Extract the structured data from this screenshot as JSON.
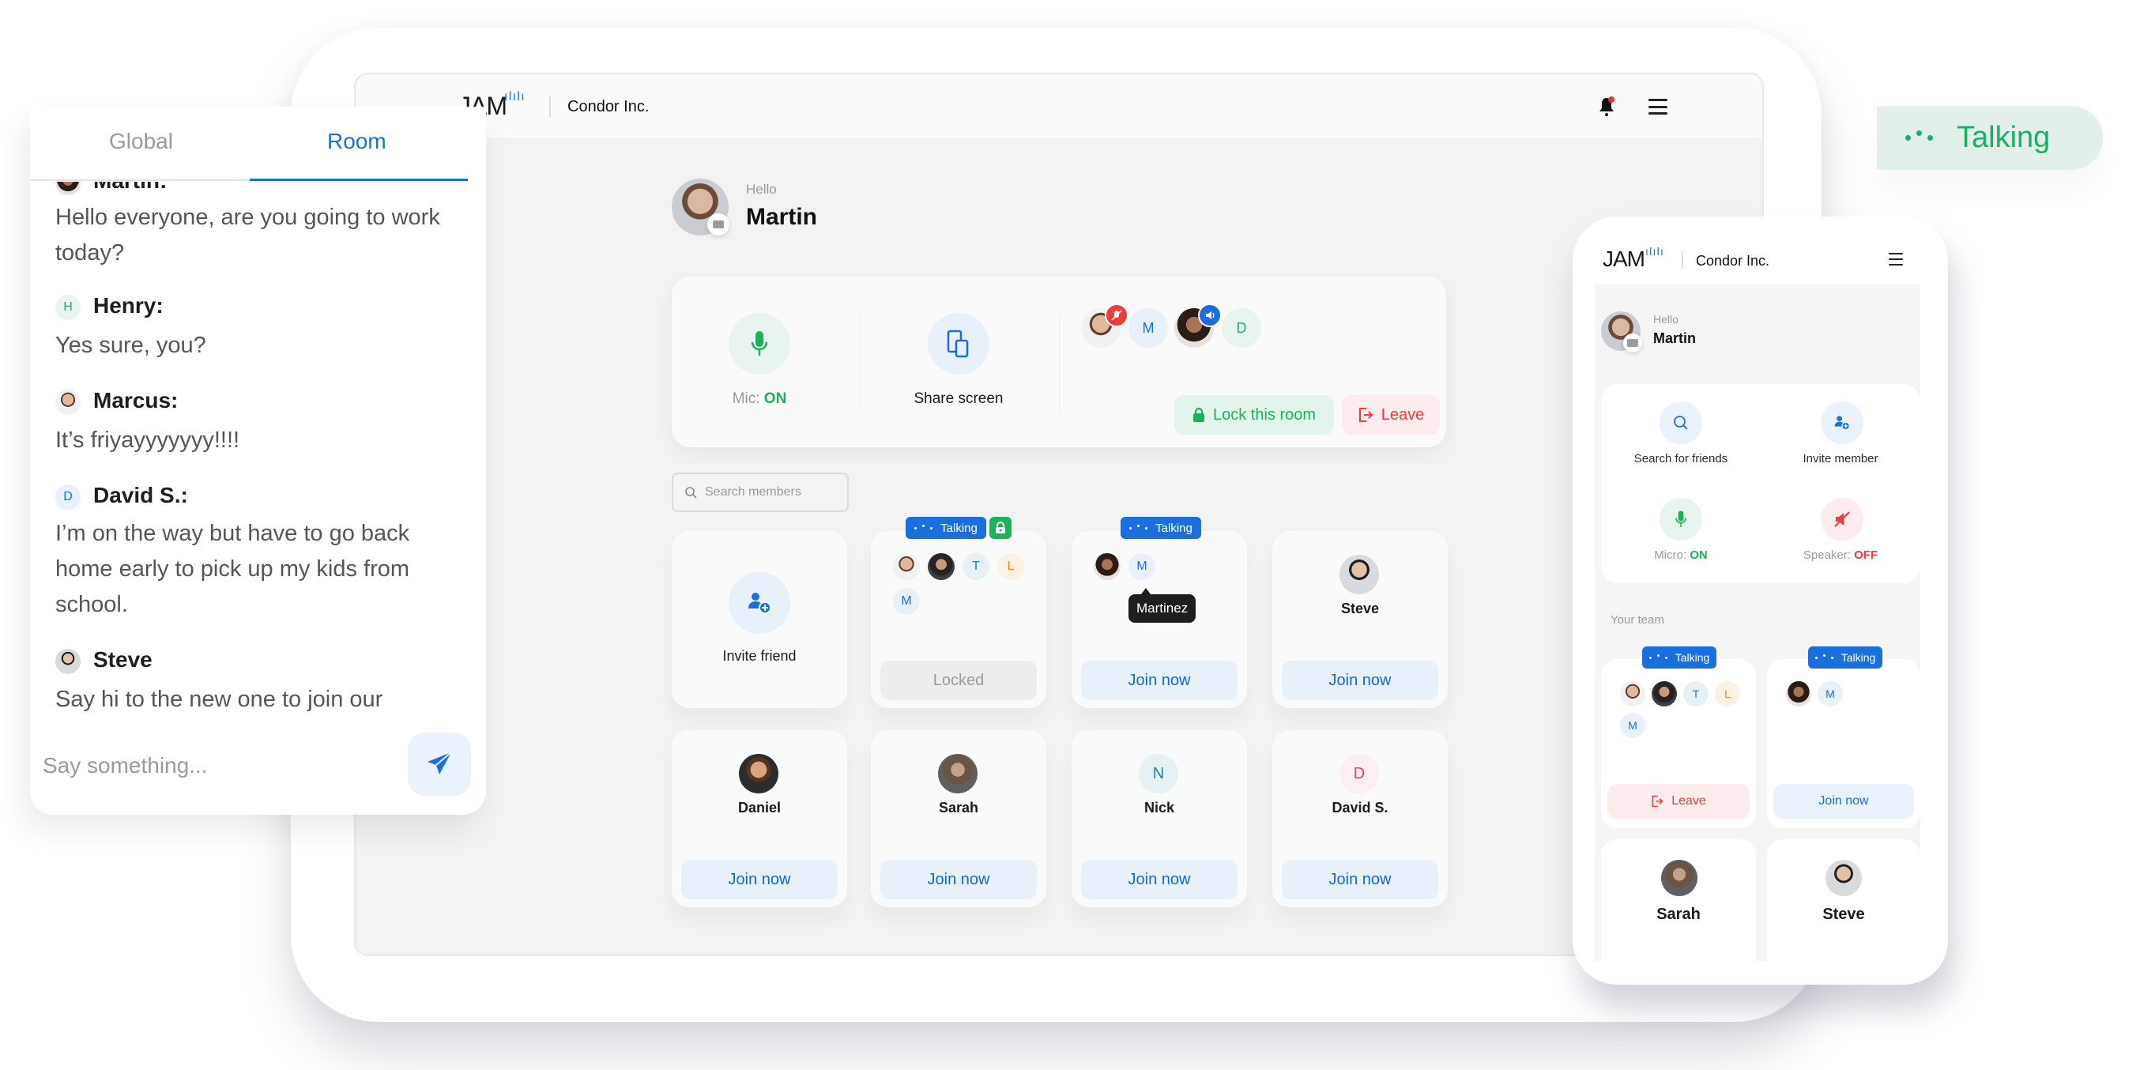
{
  "app": {
    "logo": "JAM",
    "company": "Condor Inc."
  },
  "greeting": {
    "hello": "Hello",
    "user_name": "Martin"
  },
  "controls": {
    "mic_label": "Mic:",
    "mic_state": "ON",
    "share_screen": "Share screen",
    "lock_room": "Lock this room",
    "leave": "Leave",
    "participants": [
      {
        "type": "photo",
        "status": "muted"
      },
      {
        "type": "initial",
        "initial": "M"
      },
      {
        "type": "photo",
        "status": "speaking"
      },
      {
        "type": "initial",
        "initial": "D"
      }
    ]
  },
  "search": {
    "placeholder": "Search members"
  },
  "rooms": {
    "invite_friend": "Invite friend",
    "talking_label": "Talking",
    "locked_label": "Locked",
    "join_label": "Join now",
    "room1": {
      "initials": [
        "T",
        "L",
        "M"
      ],
      "locked": true
    },
    "room2": {
      "initials": [
        "M"
      ],
      "tooltip": "Martinez"
    },
    "members": [
      {
        "name": "Steve"
      },
      {
        "name": "Daniel"
      },
      {
        "name": "Sarah"
      },
      {
        "name": "Nick",
        "initial": "N"
      },
      {
        "name": "David S.",
        "initial": "D"
      }
    ]
  },
  "chat": {
    "tabs": [
      {
        "label": "Global",
        "active": false
      },
      {
        "label": "Room",
        "active": true
      }
    ],
    "messages": [
      {
        "author": "Martin:",
        "text": "Hello everyone, are you going to work today?"
      },
      {
        "author": "Henry:",
        "initial": "H",
        "text": "Yes sure, you?"
      },
      {
        "author": "Marcus:",
        "text": "It’s friyayyyyyyy!!!!"
      },
      {
        "author": "David S.:",
        "initial": "D",
        "text": "I’m on the way but have to go back home early to pick up my kids from school."
      },
      {
        "author": "Steve",
        "text": "Say hi to the new one to join our"
      }
    ],
    "input_placeholder": "Say something..."
  },
  "floating_badge": {
    "label": "Talking"
  },
  "mobile": {
    "logo": "JAM",
    "company": "Condor Inc.",
    "hello": "Hello",
    "user_name": "Martin",
    "actions": {
      "search_friends": "Search for friends",
      "invite_member": "Invite member",
      "micro_label": "Micro:",
      "micro_state": "ON",
      "speaker_label": "Speaker:",
      "speaker_state": "OFF"
    },
    "team_heading": "Your team",
    "talking_label": "Talking",
    "room1_initials": [
      "T",
      "L",
      "M"
    ],
    "room2_initials": [
      "M"
    ],
    "leave": "Leave",
    "join": "Join now",
    "members": [
      {
        "name": "Sarah"
      },
      {
        "name": "Steve"
      }
    ]
  },
  "colors": {
    "accent_blue": "#1a6fdc",
    "green": "#1cb25c",
    "red": "#ef3b3b"
  }
}
